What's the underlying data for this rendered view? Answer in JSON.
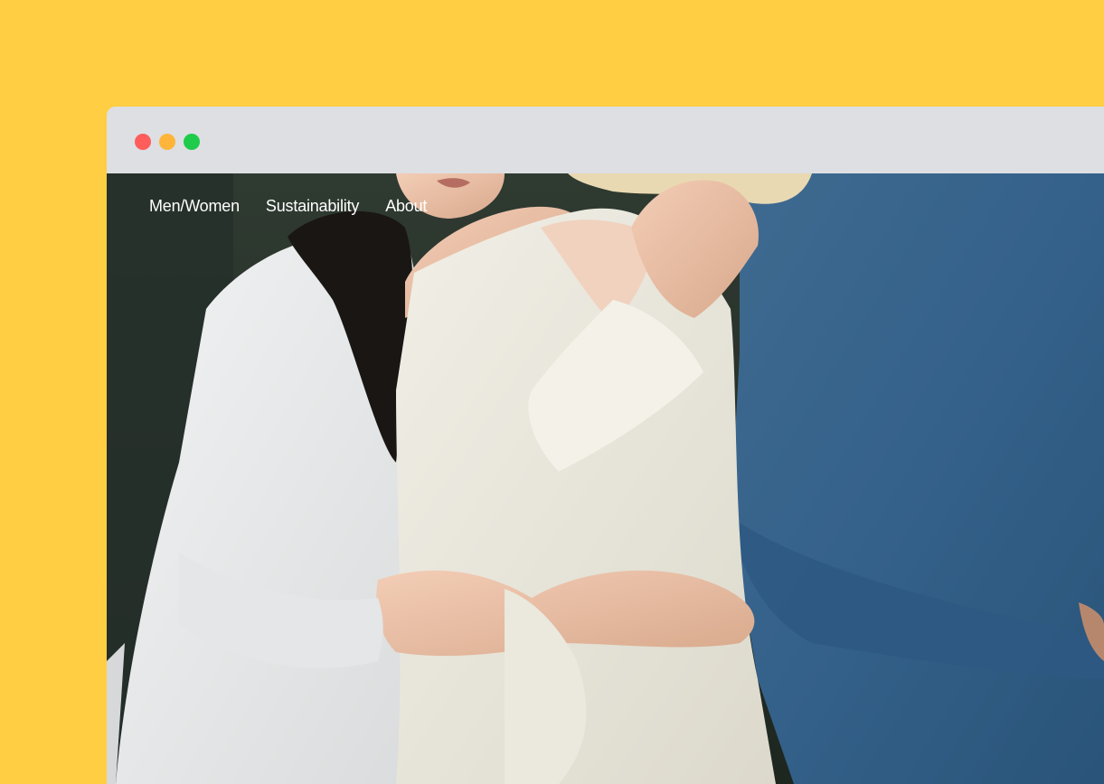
{
  "window": {
    "controls": [
      "close",
      "minimize",
      "maximize"
    ]
  },
  "colors": {
    "background": "#FFCE42",
    "titlebar": "#DDDFE3",
    "close": "#FF5C5C",
    "minimize": "#FFB53A",
    "maximize": "#1FCB4A"
  },
  "nav": {
    "items": [
      {
        "label": "Men/Women"
      },
      {
        "label": "Sustainability"
      },
      {
        "label": "About"
      }
    ]
  },
  "hero": {
    "image": "three-people-embracing-photo"
  }
}
